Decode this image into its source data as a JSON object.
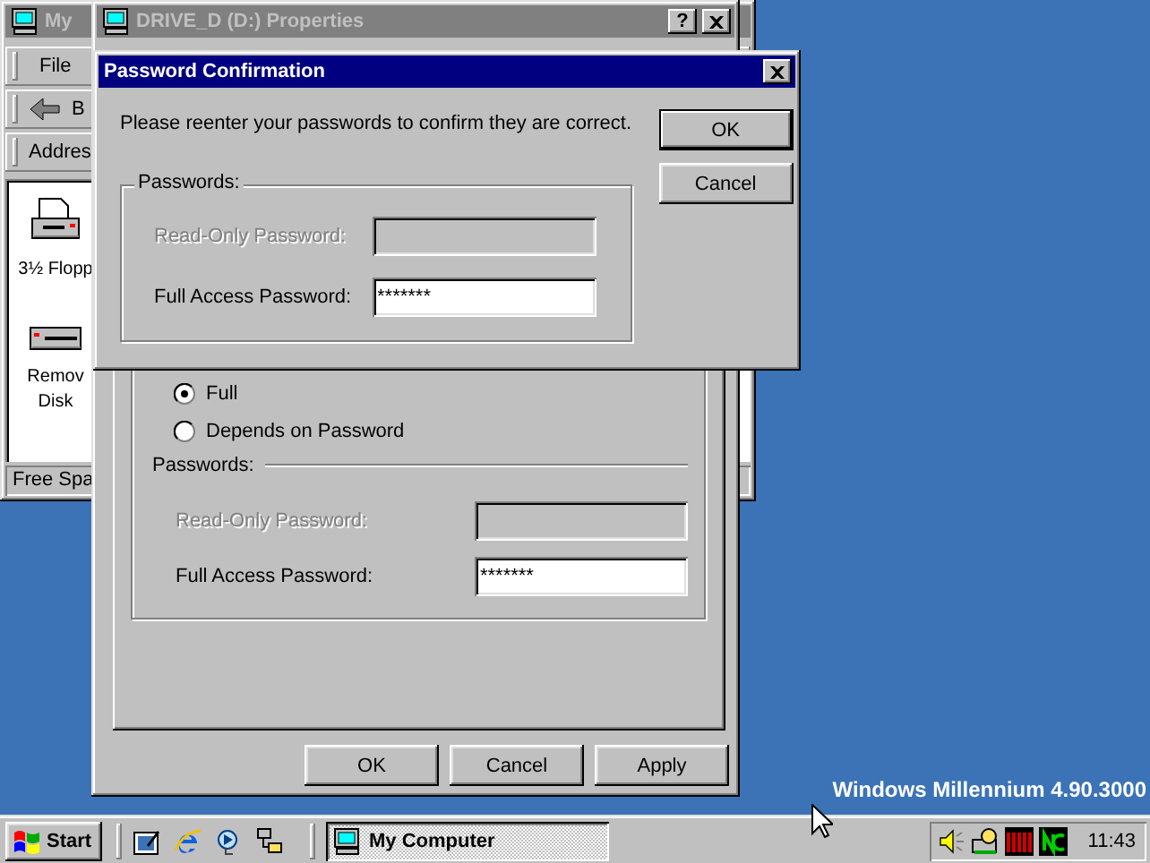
{
  "my_computer_window": {
    "title": "My",
    "active": false,
    "menu": [
      "File"
    ],
    "back_label": "B",
    "address_label": "Addres",
    "items": [
      {
        "kind": "floppy",
        "lines": [
          "3½ Flopp"
        ]
      },
      {
        "kind": "removable",
        "lines": [
          "Remov",
          "Disk"
        ]
      }
    ],
    "status": "Free Spa"
  },
  "properties_window": {
    "title": "DRIVE_D (D:) Properties",
    "active": false,
    "help_label": "?",
    "access_options": [
      {
        "label": "Full",
        "selected": true
      },
      {
        "label": "Depends on Password",
        "selected": false
      }
    ],
    "passwords_label": "Passwords:",
    "fields": [
      {
        "label": "Read-Only Password:",
        "disabled": true
      },
      {
        "label": "Full Access Password:",
        "value": "*******",
        "disabled": false
      }
    ],
    "buttons": [
      {
        "label": "OK",
        "default": false
      },
      {
        "label": "Cancel",
        "default": false
      },
      {
        "label": "Apply",
        "default": false
      }
    ]
  },
  "password_dialog": {
    "title": "Password Confirmation",
    "active": true,
    "message": "Please reenter your passwords to confirm they are correct.",
    "group_label": "Passwords:",
    "fields": [
      {
        "label": "Read-Only Password:",
        "disabled": true
      },
      {
        "label": "Full Access Password:",
        "value": "*******",
        "disabled": false
      }
    ],
    "buttons": [
      {
        "label": "OK",
        "default": true
      },
      {
        "label": "Cancel",
        "default": false
      }
    ]
  },
  "desktop": {
    "version_text": "Windows Millennium 4.90.3000"
  },
  "taskbar": {
    "start_label": "Start",
    "tasks": [
      {
        "label": "My Computer",
        "selected": true
      }
    ],
    "clock": "11:43"
  }
}
